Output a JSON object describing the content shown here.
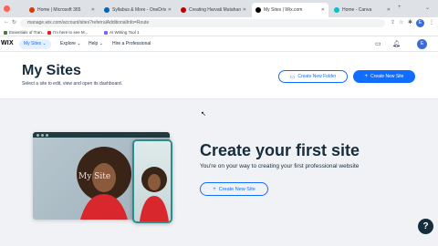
{
  "browser": {
    "tabs": [
      {
        "label": "Home | Microsoft 365",
        "color": "#d83b01"
      },
      {
        "label": "Syllabus & More - OneDrive",
        "color": "#0364b8"
      },
      {
        "label": "Creating Harvati Mutahanti | ...",
        "color": "#c00000"
      },
      {
        "label": "My Sites | Wix.com",
        "color": "#000000"
      },
      {
        "label": "Home - Canva",
        "color": "#00c4cc"
      }
    ],
    "url": "manage.wix.com/account/sites?referralAdditionalInfo=Route",
    "profile_initial": "E",
    "bookmarks": [
      {
        "label": "Essentials of Tran...",
        "color": "#4a7a3c"
      },
      {
        "label": "I'm here to see M...",
        "color": "#e62117"
      },
      {
        "label": "AI Writing Tool 1",
        "color": "#7b61ff"
      }
    ]
  },
  "wix": {
    "logo": "WIX",
    "my_sites_tab": "My Sites",
    "menus": [
      "Explore",
      "Help",
      "Hire a Professional"
    ],
    "avatar_initial": "E"
  },
  "page": {
    "title": "My Sites",
    "subtitle": "Select a site to edit, view and open its dashboard.",
    "create_folder_label": "Create New Folder",
    "create_site_label": "Create New Site"
  },
  "empty_state": {
    "title": "Create your first site",
    "subtitle": "You're on your way to creating your first professional website",
    "button_label": "Create New Site",
    "mock_text": "My Site"
  },
  "colors": {
    "accent": "#116dff",
    "text_dark": "#162d3d",
    "help_bg": "#162d3d"
  },
  "help_label": "?"
}
